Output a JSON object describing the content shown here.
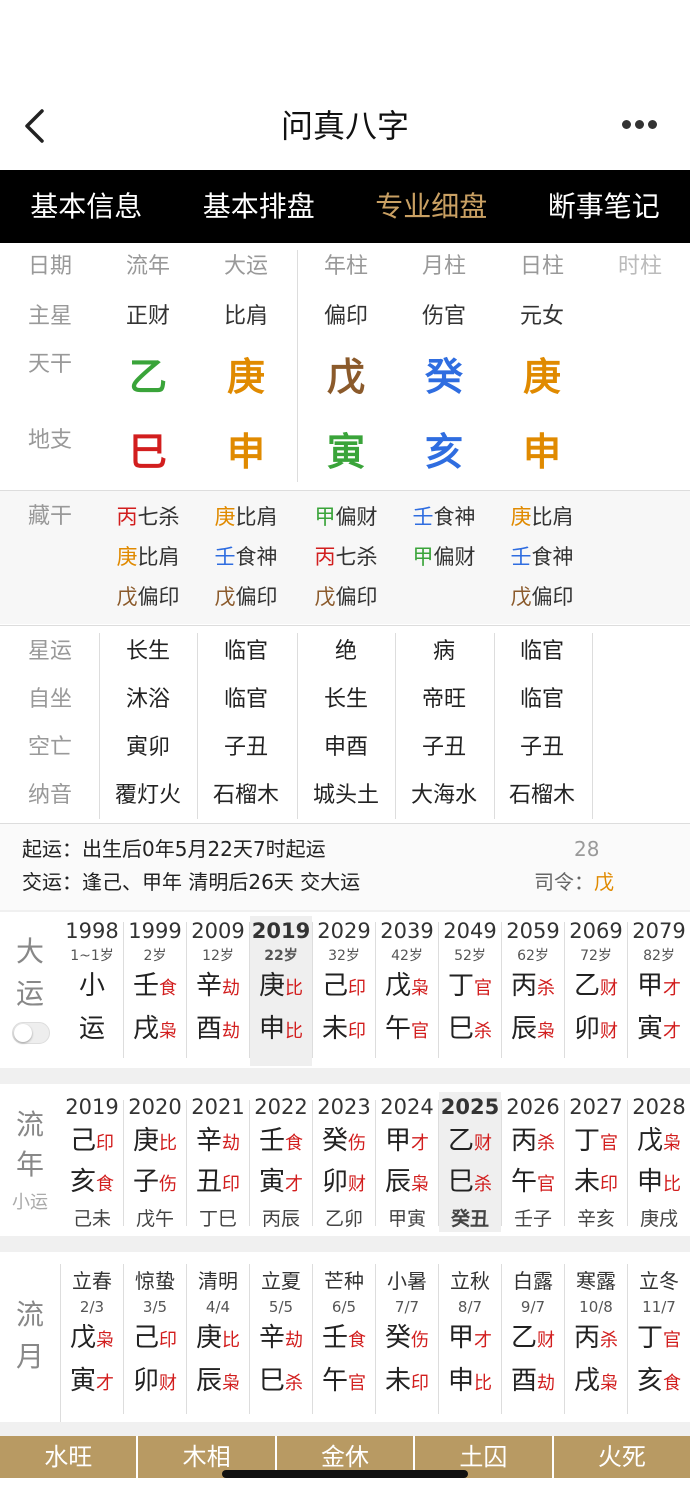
{
  "app": {
    "title": "问真八字"
  },
  "tabs": [
    "基本信息",
    "基本排盘",
    "专业细盘",
    "断事笔记"
  ],
  "grid": {
    "headers": [
      "日期",
      "流年",
      "大运",
      "年柱",
      "月柱",
      "日柱",
      "时柱"
    ],
    "row_labels": {
      "zhuxing": "主星",
      "tiangan": "天干",
      "dizhi": "地支",
      "canggan": "藏干"
    },
    "zhuxing": [
      "正财",
      "比肩",
      "偏印",
      "伤官",
      "元女",
      ""
    ],
    "tiangan": [
      {
        "t": "乙",
        "c": "#3aa43a"
      },
      {
        "t": "庚",
        "c": "#e08a00"
      },
      {
        "t": "戊",
        "c": "#8b5a2b"
      },
      {
        "t": "癸",
        "c": "#2f6de0"
      },
      {
        "t": "庚",
        "c": "#e08a00"
      }
    ],
    "dizhi": [
      {
        "t": "巳",
        "c": "#d21e1e"
      },
      {
        "t": "申",
        "c": "#e08a00"
      },
      {
        "t": "寅",
        "c": "#3aa43a"
      },
      {
        "t": "亥",
        "c": "#2f6de0"
      },
      {
        "t": "申",
        "c": "#e08a00"
      }
    ],
    "canggan": [
      [
        {
          "g": "丙",
          "c": "#d21e1e",
          "s": "七杀"
        },
        {
          "g": "庚",
          "c": "#e08a00",
          "s": "比肩"
        },
        {
          "g": "戊",
          "c": "#8b5a2b",
          "s": "偏印"
        }
      ],
      [
        {
          "g": "庚",
          "c": "#e08a00",
          "s": "比肩"
        },
        {
          "g": "壬",
          "c": "#2f6de0",
          "s": "食神"
        },
        {
          "g": "戊",
          "c": "#8b5a2b",
          "s": "偏印"
        }
      ],
      [
        {
          "g": "甲",
          "c": "#3aa43a",
          "s": "偏财"
        },
        {
          "g": "丙",
          "c": "#d21e1e",
          "s": "七杀"
        },
        {
          "g": "戊",
          "c": "#8b5a2b",
          "s": "偏印"
        }
      ],
      [
        {
          "g": "壬",
          "c": "#2f6de0",
          "s": "食神"
        },
        {
          "g": "甲",
          "c": "#3aa43a",
          "s": "偏财"
        }
      ],
      [
        {
          "g": "庚",
          "c": "#e08a00",
          "s": "比肩"
        },
        {
          "g": "壬",
          "c": "#2f6de0",
          "s": "食神"
        },
        {
          "g": "戊",
          "c": "#8b5a2b",
          "s": "偏印"
        }
      ]
    ]
  },
  "stars": {
    "labels": [
      "星运",
      "自坐",
      "空亡",
      "纳音"
    ],
    "rows": [
      [
        "长生",
        "临官",
        "绝",
        "病",
        "临官"
      ],
      [
        "沐浴",
        "临官",
        "长生",
        "帝旺",
        "临官"
      ],
      [
        "寅卯",
        "子丑",
        "申酉",
        "子丑",
        "子丑"
      ],
      [
        "覆灯火",
        "石榴木",
        "城头土",
        "大海水",
        "石榴木"
      ]
    ]
  },
  "yun": {
    "qiyun": "起运：出生后0年5月22天7时起运",
    "jiaoyun": "交运：逢己、甲年 清明后26天 交大运",
    "num": "28",
    "siling": "司令：",
    "siling_val": "戊"
  },
  "dayun": {
    "label1": "大",
    "label2": "运",
    "cols": [
      {
        "y": "1998",
        "a": "1~1岁",
        "g": "小",
        "gs": "",
        "gc": "#222",
        "z": "运",
        "zs": "",
        "zc": "#222"
      },
      {
        "y": "1999",
        "a": "2岁",
        "g": "壬",
        "gs": "食",
        "gc": "#d21e1e",
        "z": "戌",
        "zs": "枭",
        "zc": "#d21e1e"
      },
      {
        "y": "2009",
        "a": "12岁",
        "g": "辛",
        "gs": "劫",
        "gc": "#d21e1e",
        "z": "酉",
        "zs": "劫",
        "zc": "#d21e1e"
      },
      {
        "y": "2019",
        "a": "22岁",
        "g": "庚",
        "gs": "比",
        "gc": "#d21e1e",
        "z": "申",
        "zs": "比",
        "zc": "#d21e1e",
        "active": true
      },
      {
        "y": "2029",
        "a": "32岁",
        "g": "己",
        "gs": "印",
        "gc": "#d21e1e",
        "z": "未",
        "zs": "印",
        "zc": "#d21e1e"
      },
      {
        "y": "2039",
        "a": "42岁",
        "g": "戊",
        "gs": "枭",
        "gc": "#d21e1e",
        "z": "午",
        "zs": "官",
        "zc": "#d21e1e"
      },
      {
        "y": "2049",
        "a": "52岁",
        "g": "丁",
        "gs": "官",
        "gc": "#d21e1e",
        "z": "巳",
        "zs": "杀",
        "zc": "#d21e1e"
      },
      {
        "y": "2059",
        "a": "62岁",
        "g": "丙",
        "gs": "杀",
        "gc": "#d21e1e",
        "z": "辰",
        "zs": "枭",
        "zc": "#d21e1e"
      },
      {
        "y": "2069",
        "a": "72岁",
        "g": "乙",
        "gs": "财",
        "gc": "#d21e1e",
        "z": "卯",
        "zs": "财",
        "zc": "#d21e1e"
      },
      {
        "y": "2079",
        "a": "82岁",
        "g": "甲",
        "gs": "才",
        "gc": "#d21e1e",
        "z": "寅",
        "zs": "才",
        "zc": "#d21e1e"
      }
    ]
  },
  "liunian": {
    "label1": "流",
    "label2": "年",
    "label3": "小运",
    "cols": [
      {
        "y": "2019",
        "g": "己",
        "gs": "印",
        "z": "亥",
        "zs": "食",
        "x": "己未"
      },
      {
        "y": "2020",
        "g": "庚",
        "gs": "比",
        "z": "子",
        "zs": "伤",
        "x": "戊午"
      },
      {
        "y": "2021",
        "g": "辛",
        "gs": "劫",
        "z": "丑",
        "zs": "印",
        "x": "丁巳"
      },
      {
        "y": "2022",
        "g": "壬",
        "gs": "食",
        "z": "寅",
        "zs": "才",
        "x": "丙辰"
      },
      {
        "y": "2023",
        "g": "癸",
        "gs": "伤",
        "z": "卯",
        "zs": "财",
        "x": "乙卯"
      },
      {
        "y": "2024",
        "g": "甲",
        "gs": "才",
        "z": "辰",
        "zs": "枭",
        "x": "甲寅"
      },
      {
        "y": "2025",
        "g": "乙",
        "gs": "财",
        "z": "巳",
        "zs": "杀",
        "x": "癸丑",
        "active": true
      },
      {
        "y": "2026",
        "g": "丙",
        "gs": "杀",
        "z": "午",
        "zs": "官",
        "x": "壬子"
      },
      {
        "y": "2027",
        "g": "丁",
        "gs": "官",
        "z": "未",
        "zs": "印",
        "x": "辛亥"
      },
      {
        "y": "2028",
        "g": "戊",
        "gs": "枭",
        "z": "申",
        "zs": "比",
        "x": "庚戌"
      }
    ]
  },
  "liuyue": {
    "label1": "流",
    "label2": "月",
    "cols": [
      {
        "jq": "立春",
        "d": "2/3",
        "g": "戊",
        "gs": "枭",
        "z": "寅",
        "zs": "才"
      },
      {
        "jq": "惊蛰",
        "d": "3/5",
        "g": "己",
        "gs": "印",
        "z": "卯",
        "zs": "财"
      },
      {
        "jq": "清明",
        "d": "4/4",
        "g": "庚",
        "gs": "比",
        "z": "辰",
        "zs": "枭"
      },
      {
        "jq": "立夏",
        "d": "5/5",
        "g": "辛",
        "gs": "劫",
        "z": "巳",
        "zs": "杀"
      },
      {
        "jq": "芒种",
        "d": "6/5",
        "g": "壬",
        "gs": "食",
        "z": "午",
        "zs": "官"
      },
      {
        "jq": "小暑",
        "d": "7/7",
        "g": "癸",
        "gs": "伤",
        "z": "未",
        "zs": "印"
      },
      {
        "jq": "立秋",
        "d": "8/7",
        "g": "甲",
        "gs": "才",
        "z": "申",
        "zs": "比"
      },
      {
        "jq": "白露",
        "d": "9/7",
        "g": "乙",
        "gs": "财",
        "z": "酉",
        "zs": "劫"
      },
      {
        "jq": "寒露",
        "d": "10/8",
        "g": "丙",
        "gs": "杀",
        "z": "戌",
        "zs": "枭"
      },
      {
        "jq": "立冬",
        "d": "11/7",
        "g": "丁",
        "gs": "官",
        "z": "亥",
        "zs": "食"
      }
    ]
  },
  "wangxiang": [
    "水旺",
    "木相",
    "金休",
    "土囚",
    "火死"
  ]
}
